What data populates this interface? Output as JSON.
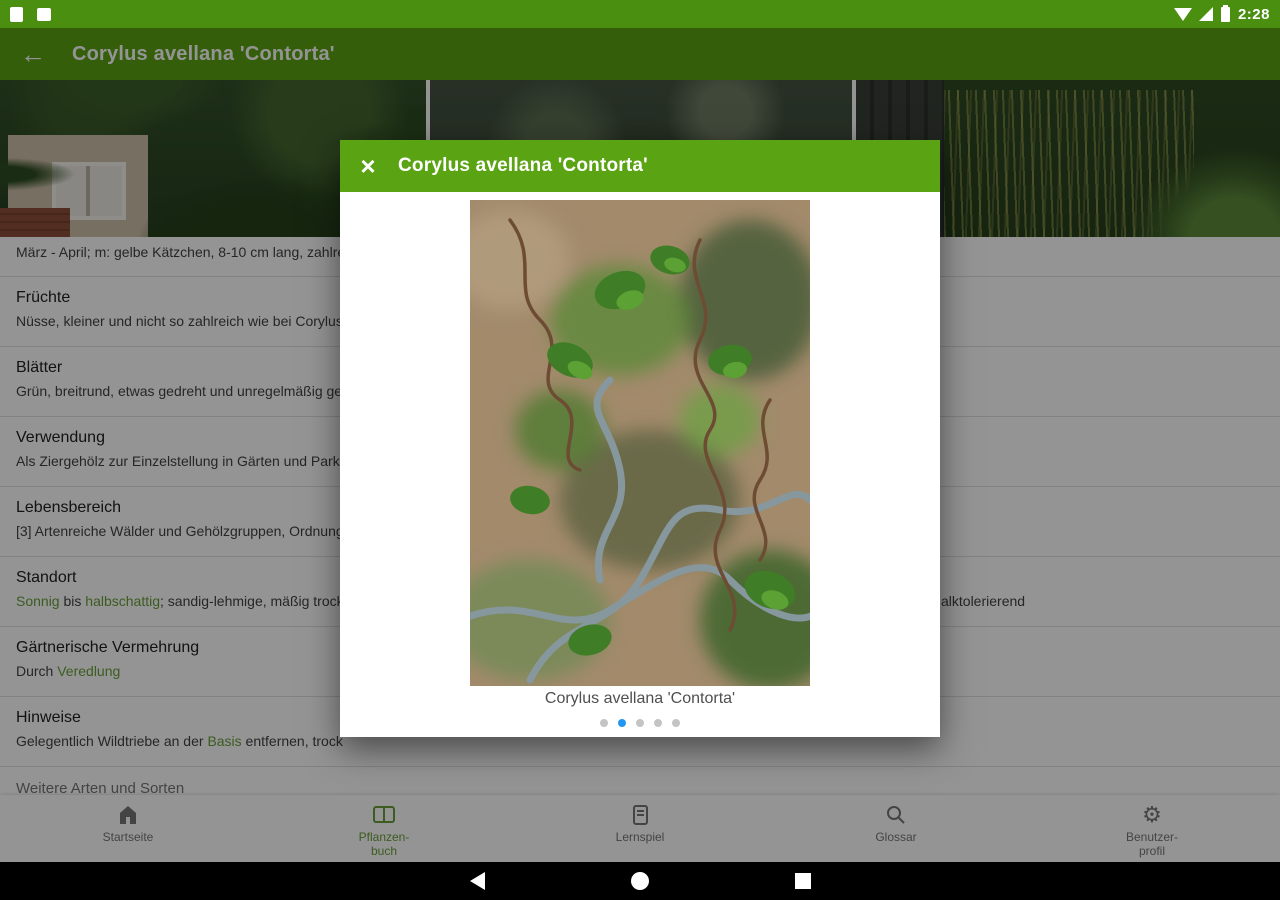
{
  "status_bar": {
    "time": "2:28",
    "icons": [
      "notification-icon",
      "screenshot-icon",
      "wifi-icon",
      "cell-signal-icon",
      "battery-icon"
    ]
  },
  "app_bar": {
    "back_icon": "arrow-left-icon",
    "title": "Corylus avellana 'Contorta'"
  },
  "modal": {
    "close_icon": "close-icon",
    "title": "Corylus avellana 'Contorta'",
    "caption": "Corylus avellana 'Contorta'",
    "carousel": {
      "dot_count": 5,
      "active_index": 1
    }
  },
  "sections": [
    {
      "heading": "",
      "body": [
        {
          "text": "März - April; m: gelbe Kätzchen, 8-10 cm lang, zahlre"
        }
      ]
    },
    {
      "heading": "Früchte",
      "body": [
        {
          "text": "Nüsse, kleiner und nicht so zahlreich wie bei Corylus"
        }
      ]
    },
    {
      "heading": "Blätter",
      "body": [
        {
          "text": "Grün, breitrund, etwas gedreht und unregelmäßig ge"
        }
      ]
    },
    {
      "heading": "Verwendung",
      "body": [
        {
          "text": "Als Ziergehölz zur Einzelstellung in Gärten und Park"
        }
      ]
    },
    {
      "heading": "Lebensbereich",
      "body": [
        {
          "text": "[3] Artenreiche Wälder und Gehölzgruppen, Ordnung"
        }
      ]
    },
    {
      "heading": "Standort",
      "body": [
        {
          "text": "Sonnig",
          "link": true
        },
        {
          "text": " bis "
        },
        {
          "text": "halbschattig",
          "link": true
        },
        {
          "text": "; sandig-lehmige, mäßig trock"
        }
      ],
      "overflow_right": "alktolerierend"
    },
    {
      "heading": "Gärtnerische Vermehrung",
      "body": [
        {
          "text": "Durch "
        },
        {
          "text": "Veredlung",
          "link": true
        }
      ]
    },
    {
      "heading": "Hinweise",
      "body": [
        {
          "text": "Gelegentlich Wildtriebe an der "
        },
        {
          "text": "Basis",
          "link": true
        },
        {
          "text": " entfernen, trock"
        }
      ]
    }
  ],
  "more_section_label": "Weitere Arten und Sorten",
  "tab_bar": [
    {
      "id": "startseite",
      "icon": "home-icon",
      "label_lines": [
        "Startseite"
      ],
      "active": false
    },
    {
      "id": "pflanzenbuch",
      "icon": "book-icon",
      "label_lines": [
        "Pflanzen-",
        "buch"
      ],
      "active": true
    },
    {
      "id": "lernspiel",
      "icon": "game-card-icon",
      "label_lines": [
        "Lernspiel"
      ],
      "active": false
    },
    {
      "id": "glossar",
      "icon": "search-icon",
      "label_lines": [
        "Glossar"
      ],
      "active": false
    },
    {
      "id": "benutzerprofil",
      "icon": "gear-icon",
      "label_lines": [
        "Benutzer-",
        "profil"
      ],
      "active": false
    }
  ],
  "nav_bar": {
    "icons": [
      "back-triangle-icon",
      "home-circle-icon",
      "recents-square-icon"
    ]
  },
  "colors": {
    "primary_green": "#5aa312",
    "status_bar_green": "#4a8f10",
    "link_green": "#689F38",
    "active_tab_green": "#689F38",
    "dot_active_blue": "#2196F3"
  }
}
